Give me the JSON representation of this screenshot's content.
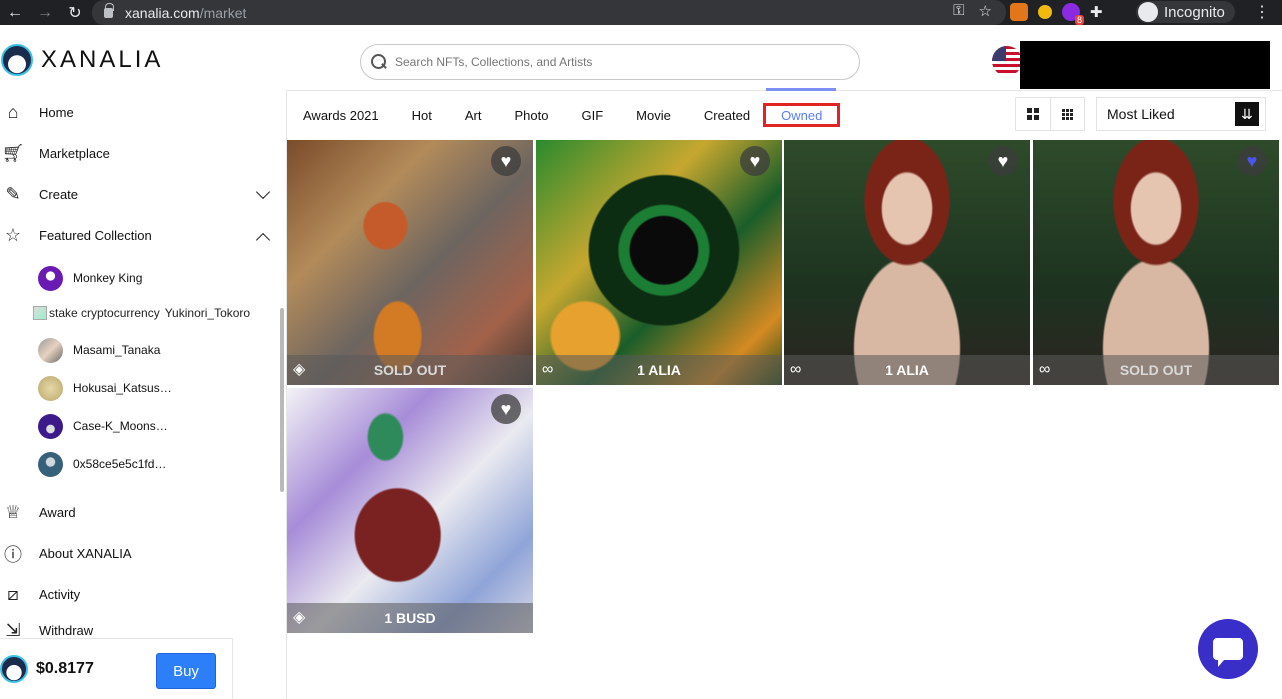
{
  "browser": {
    "url_domain": "xanalia.com",
    "url_path": "/market",
    "incognito_label": "Incognito",
    "extension_badge": "8"
  },
  "header": {
    "logo_text": "XANALIA",
    "search_placeholder": "Search NFTs, Collections, and Artists"
  },
  "sidebar": {
    "nav": {
      "home": "Home",
      "marketplace": "Marketplace",
      "create": "Create",
      "featured": "Featured Collection",
      "award": "Award",
      "about": "About XANALIA",
      "activity": "Activity",
      "withdraw": "Withdraw"
    },
    "collections": {
      "monkey_king": "Monkey King",
      "broken_alt": "stake cryptocurrency",
      "yukinori": "Yukinori_Tokoro",
      "masami": "Masami_Tanaka",
      "hokusai": "Hokusai_Katsus…",
      "case": "Case-K_Moons…",
      "addr": "0x58ce5e5c1fd…"
    },
    "price": "$0.8177",
    "buy_label": "Buy"
  },
  "tabs": {
    "awards": "Awards 2021",
    "hot": "Hot",
    "art": "Art",
    "photo": "Photo",
    "gif": "GIF",
    "movie": "Movie",
    "created": "Created",
    "owned": "Owned"
  },
  "sort": {
    "selected": "Most Liked"
  },
  "cards": [
    {
      "status": "SOLD OUT"
    },
    {
      "status": "1 ALIA"
    },
    {
      "status": "1 ALIA"
    },
    {
      "status": "SOLD OUT"
    },
    {
      "status": "1 BUSD"
    }
  ]
}
